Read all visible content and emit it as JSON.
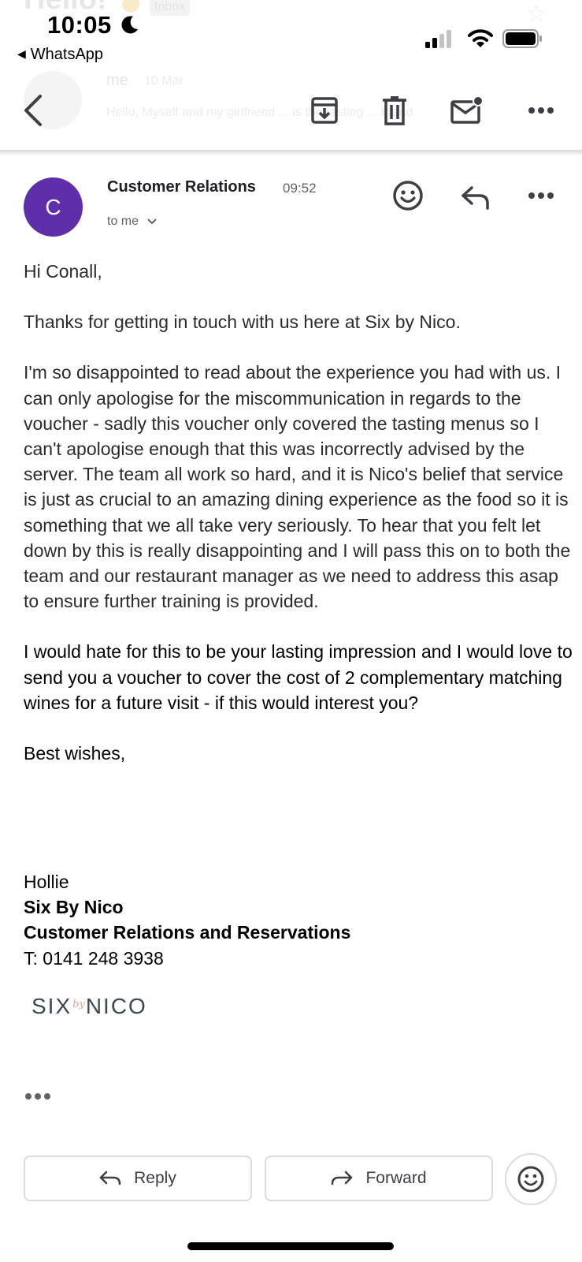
{
  "background_thread": {
    "title": "Hello!",
    "label": "Inbox",
    "from": "me",
    "date": "10 Mar",
    "snippet": "Hello, Myself and my girlfriend ... is the tasting ... brand"
  },
  "status_bar": {
    "time": "10:05",
    "back_app": "WhatsApp"
  },
  "toolbar": {
    "icons": [
      "back-arrow-icon",
      "archive-icon",
      "trash-icon",
      "mark-unread-icon",
      "more-icon"
    ]
  },
  "email": {
    "avatar_letter": "C",
    "avatar_color": "#5f2eaa",
    "sender": "Customer Relations",
    "time": "09:52",
    "recipient": "to me",
    "greeting": "Hi Conall,",
    "paragraph1": "Thanks for getting in touch with us here at Six by Nico.",
    "paragraph2": "I'm so disappointed to read about the experience you had with us. I can only apologise for the miscommunication in regards to the voucher - sadly this voucher only covered the tasting menus so I can't apologise enough that this was incorrectly advised by the server. The team all work so hard, and it is Nico's belief that service is just as crucial to an amazing dining experience as the food so it is something that we all take very seriously. To hear that you felt let down by this is really disappointing and I will pass this on to both the team and our restaurant manager as we need to address this asap to ensure further training is provided.",
    "paragraph3": "I would hate for this to be your lasting impression and I would love to send you a voucher to cover the cost of 2 complementary matching wines for a future visit - if this would interest you?",
    "closing": "Best wishes,",
    "signature": {
      "name": "Hollie",
      "company": "Six By Nico",
      "role": "Customer Relations and Reservations",
      "phone": "T: 0141 248 3938"
    },
    "logo": {
      "left": "SIX",
      "middle": "by",
      "right": "NICO"
    }
  },
  "actions": {
    "reply_label": "Reply",
    "forward_label": "Forward"
  }
}
